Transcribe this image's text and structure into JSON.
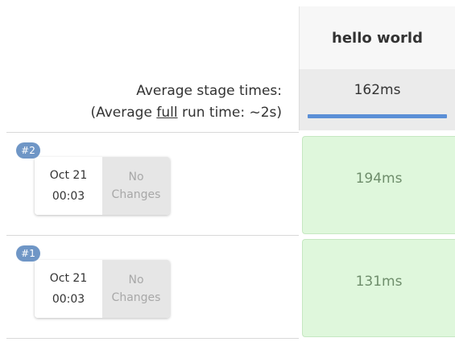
{
  "stage_header": {
    "title": "hello world"
  },
  "average": {
    "label_line1": "Average stage times:",
    "label_prefix": "(Average ",
    "label_underlined": "full",
    "label_suffix": " run time: ~2s)",
    "value": "162ms",
    "bar_fill_fraction": 1.0,
    "bar_color": "#5b8fd6"
  },
  "builds": [
    {
      "badge": "#2",
      "date": "Oct 21",
      "time": "00:03",
      "changes_line1": "No",
      "changes_line2": "Changes",
      "stage_time": "194ms"
    },
    {
      "badge": "#1",
      "date": "Oct 21",
      "time": "00:03",
      "changes_line1": "No",
      "changes_line2": "Changes",
      "stage_time": "131ms"
    }
  ],
  "colors": {
    "success_cell_bg": "#dff7dc",
    "badge_bg": "#6f96c6"
  }
}
